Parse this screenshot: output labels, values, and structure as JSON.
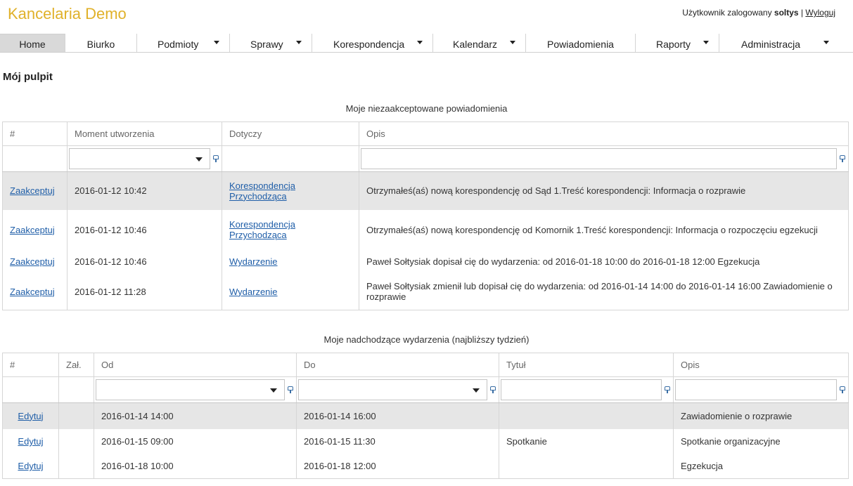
{
  "app": {
    "title": "Kancelaria Demo",
    "user_prefix": "Użytkownik zalogowany",
    "username": "soltys",
    "separator": "|",
    "logout": "Wyloguj"
  },
  "menu": [
    {
      "label": "Home",
      "dropdown": false,
      "active": true
    },
    {
      "label": "Biurko",
      "dropdown": false
    },
    {
      "label": "Podmioty",
      "dropdown": true
    },
    {
      "label": "Sprawy",
      "dropdown": true
    },
    {
      "label": "Korespondencja",
      "dropdown": true
    },
    {
      "label": "Kalendarz",
      "dropdown": true
    },
    {
      "label": "Powiadomienia",
      "dropdown": false
    },
    {
      "label": "Raporty",
      "dropdown": true
    },
    {
      "label": "Administracja",
      "dropdown": true
    }
  ],
  "page_title": "Mój pulpit",
  "notifications": {
    "caption": "Moje niezaakceptowane powiadomienia",
    "headers": [
      "#",
      "Moment utworzenia",
      "Dotyczy",
      "Opis"
    ],
    "rows": [
      {
        "action": "Zaakceptuj",
        "moment": "2016-01-12 10:42",
        "dotyczy_line1": "Korespondencja",
        "dotyczy_line2": "Przychodząca",
        "opis": "Otrzymałeś(aś) nową korespondencję od Sąd 1.Treść korespondencji: Informacja o rozprawie"
      },
      {
        "action": "Zaakceptuj",
        "moment": "2016-01-12 10:46",
        "dotyczy_line1": "Korespondencja",
        "dotyczy_line2": "Przychodząca",
        "opis": "Otrzymałeś(aś) nową korespondencję od Komornik 1.Treść korespondencji: Informacja o rozpoczęciu egzekucji"
      },
      {
        "action": "Zaakceptuj",
        "moment": "2016-01-12 10:46",
        "dotyczy_line1": "Wydarzenie",
        "dotyczy_line2": "",
        "opis": "Paweł Sołtysiak dopisał cię do wydarzenia: od 2016-01-18 10:00 do 2016-01-18 12:00 Egzekucja"
      },
      {
        "action": "Zaakceptuj",
        "moment": "2016-01-12 11:28",
        "dotyczy_line1": "Wydarzenie",
        "dotyczy_line2": "",
        "opis": "Paweł Sołtysiak zmienił lub dopisał cię do wydarzenia: od 2016-01-14 14:00 do 2016-01-14 16:00 Zawiadomienie o rozprawie"
      }
    ]
  },
  "events": {
    "caption": "Moje nadchodzące wydarzenia (najbliższy tydzień)",
    "headers": [
      "#",
      "Zał.",
      "Od",
      "Do",
      "Tytuł",
      "Opis"
    ],
    "rows": [
      {
        "action": "Edytuj",
        "zal": "",
        "od": "2016-01-14 14:00",
        "do": "2016-01-14 16:00",
        "tytul": "",
        "opis": "Zawiadomienie o rozprawie"
      },
      {
        "action": "Edytuj",
        "zal": "",
        "od": "2016-01-15 09:00",
        "do": "2016-01-15 11:30",
        "tytul": "Spotkanie",
        "opis": "Spotkanie organizacyjne"
      },
      {
        "action": "Edytuj",
        "zal": "",
        "od": "2016-01-18 10:00",
        "do": "2016-01-18 12:00",
        "tytul": "",
        "opis": "Egzekucja"
      }
    ]
  }
}
